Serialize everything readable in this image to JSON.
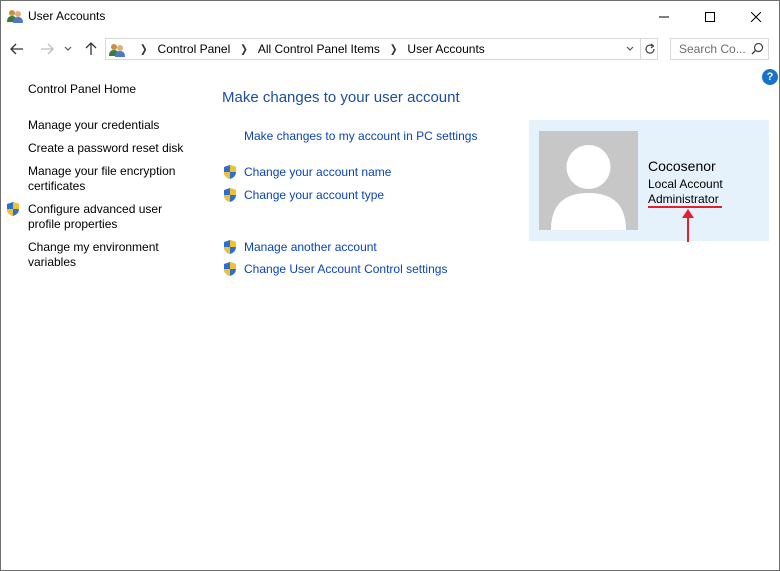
{
  "window": {
    "title": "User Accounts"
  },
  "nav": {
    "breadcrumbs": [
      "Control Panel",
      "All Control Panel Items",
      "User Accounts"
    ],
    "search_placeholder": "Search Co..."
  },
  "sidebar": {
    "items": [
      {
        "label": "Control Panel Home"
      },
      {
        "label": "Manage your credentials"
      },
      {
        "label": "Create a password reset disk"
      },
      {
        "label": "Manage your file encryption certificates"
      },
      {
        "label": "Configure advanced user profile properties"
      },
      {
        "label": "Change my environment variables"
      }
    ]
  },
  "main": {
    "heading": "Make changes to your user account",
    "links": [
      {
        "label": "Make changes to my account in PC settings"
      },
      {
        "label": "Change your account name"
      },
      {
        "label": "Change your account type"
      },
      {
        "label": "Manage another account"
      },
      {
        "label": "Change User Account Control settings"
      }
    ]
  },
  "account": {
    "name": "Cocosenor",
    "type": "Local Account",
    "role": "Administrator"
  },
  "colors": {
    "accent": "#1e4d9b",
    "link": "#0b44b8",
    "panel": "#e5f1fb",
    "annotation": "#e0202a"
  }
}
